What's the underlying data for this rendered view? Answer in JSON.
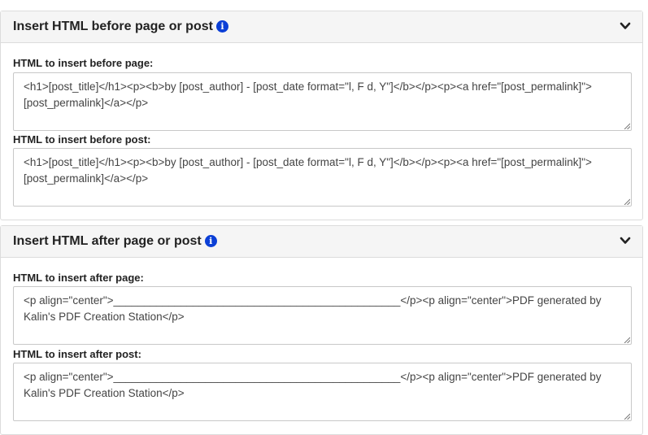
{
  "sections": {
    "before": {
      "title": "Insert HTML before page or post",
      "page_label": "HTML to insert before page:",
      "page_value": "<h1>[post_title]</h1><p><b>by [post_author] - [post_date  format=\"l, F d, Y\"]</b></p><p><a href=\"[post_permalink]\">[post_permalink]</a></p>",
      "post_label": "HTML to insert before post:",
      "post_value": "<h1>[post_title]</h1><p><b>by [post_author] - [post_date  format=\"l, F d, Y\"]</b></p><p><a href=\"[post_permalink]\">[post_permalink]</a></p>"
    },
    "after": {
      "title": "Insert HTML after page or post",
      "page_label": "HTML to insert after page:",
      "page_value": "<p align=\"center\">_______________________________________________</p><p align=\"center\">PDF generated by Kalin's PDF Creation Station</p>",
      "post_label": "HTML to insert after post:",
      "post_value": "<p align=\"center\">_______________________________________________</p><p align=\"center\">PDF generated by Kalin's PDF Creation Station</p>"
    }
  },
  "icons": {
    "info": "info-icon",
    "collapse": "chevron-down-icon",
    "resize": "resize-grip-icon"
  },
  "colors": {
    "info_icon": "#0b3fd6",
    "header_bg": "#f5f5f5",
    "border": "#dcdcdc"
  }
}
